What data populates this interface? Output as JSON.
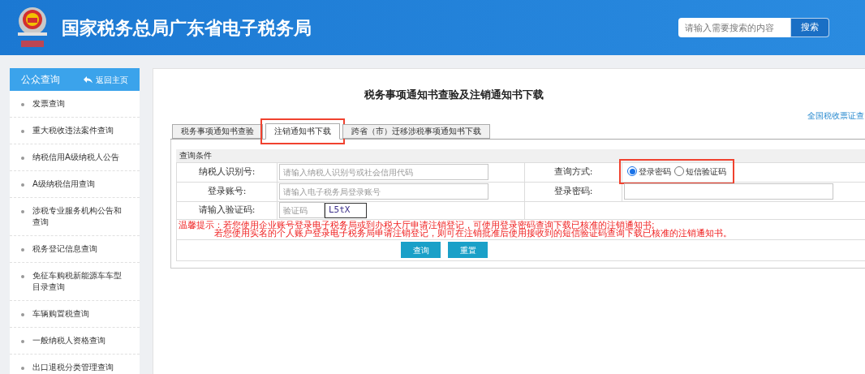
{
  "header": {
    "title": "国家税务总局广东省电子税务局",
    "search": {
      "placeholder": "请输入需要搜索的内容",
      "button": "搜索"
    }
  },
  "sidebar": {
    "title": "公众查询",
    "back": "返回主页",
    "items": [
      {
        "label": "发票查询"
      },
      {
        "label": "重大税收违法案件查询"
      },
      {
        "label": "纳税信用A级纳税人公告"
      },
      {
        "label": "A级纳税信用查询"
      },
      {
        "label": "涉税专业服务机构公告和查询"
      },
      {
        "label": "税务登记信息查询"
      },
      {
        "label": "免征车购税新能源车车型目录查询"
      },
      {
        "label": "车辆购置税查询"
      },
      {
        "label": "一般纳税人资格查询"
      },
      {
        "label": "出口退税分类管理查询"
      }
    ]
  },
  "main": {
    "title": "税务事项通知书查验及注销通知书下载",
    "link": "全国税收票证查",
    "tabs": [
      {
        "label": "税务事项通知书查验",
        "selected": false,
        "highlighted": false
      },
      {
        "label": "注销通知书下载",
        "selected": true,
        "highlighted": true
      },
      {
        "label": "跨省（市）迁移涉税事项通知书下载",
        "selected": false,
        "highlighted": false
      }
    ],
    "section_title": "查询条件",
    "fields": {
      "taxpayer_id": {
        "label": "纳税人识别号:",
        "placeholder": "请输入纳税人识别号或社会信用代码"
      },
      "account": {
        "label": "登录账号:",
        "placeholder": "请输入电子税务局登录账号"
      },
      "captcha": {
        "label": "请输入验证码:",
        "placeholder": "验证码",
        "captcha_text": "L5tX"
      },
      "method": {
        "label": "查询方式:",
        "highlighted": true,
        "options": [
          {
            "label": "登录密码",
            "selected": true
          },
          {
            "label": "短信验证码",
            "selected": false
          }
        ]
      },
      "password": {
        "label": "登录密码:"
      }
    },
    "notice": [
      "温馨提示：若您使用企业账号登录电子税务局或到办税大厅申请注销登记，可使用登录密码查询下载已核准的注销通知书;",
      "若您使用实名的个人账户登录电子税务局申请注销登记，则可在注销批准后使用接收到的短信验证码查询下载已核准的注销通知书。"
    ],
    "buttons": [
      "查询",
      "重置"
    ]
  }
}
